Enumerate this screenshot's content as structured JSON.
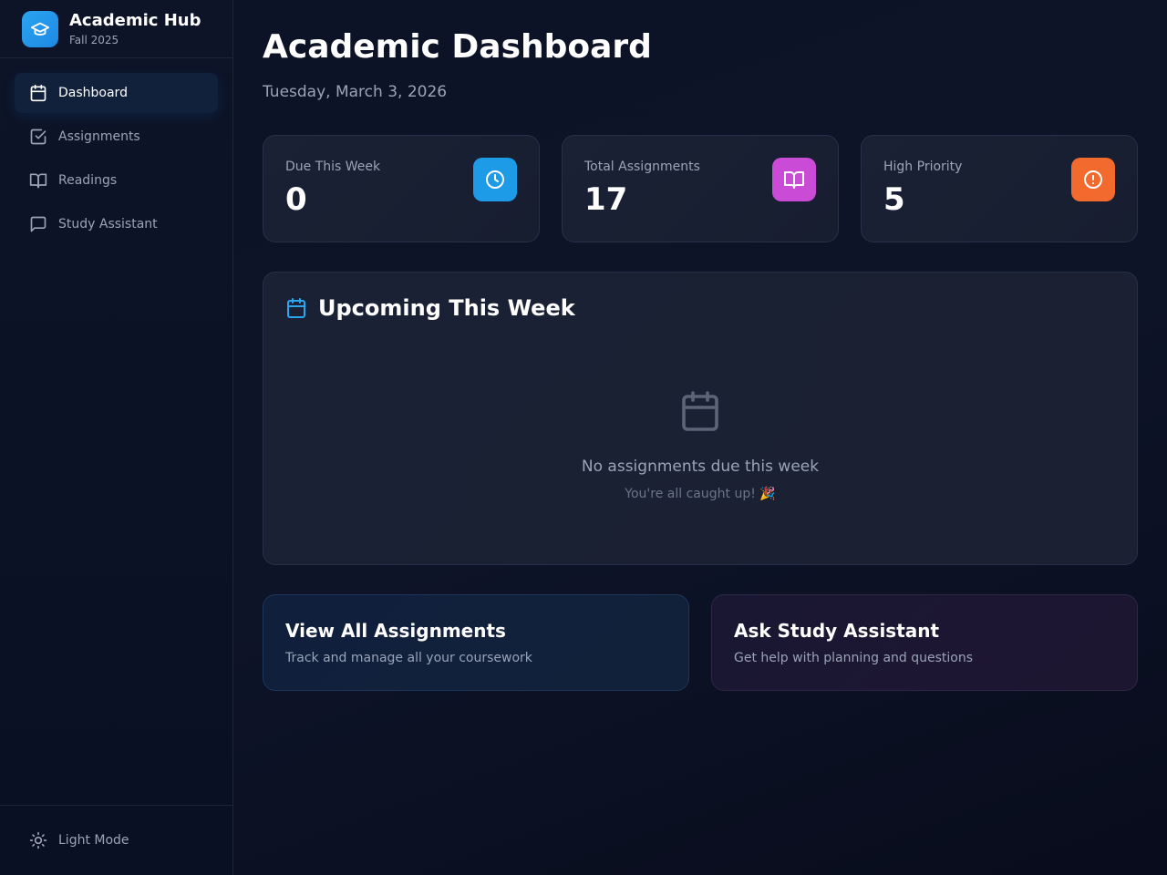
{
  "brand": {
    "title": "Academic Hub",
    "subtitle": "Fall 2025",
    "icon": "graduation-cap-icon"
  },
  "sidebar": {
    "items": [
      {
        "label": "Dashboard",
        "icon": "calendar-icon",
        "active": true
      },
      {
        "label": "Assignments",
        "icon": "checkbox-icon",
        "active": false
      },
      {
        "label": "Readings",
        "icon": "book-icon",
        "active": false
      },
      {
        "label": "Study Assistant",
        "icon": "chat-icon",
        "active": false
      }
    ],
    "footer": {
      "label": "Light Mode",
      "icon": "sun-icon"
    }
  },
  "header": {
    "title": "Academic Dashboard",
    "date": "Tuesday, March 3, 2026"
  },
  "stats": [
    {
      "label": "Due This Week",
      "value": "0",
      "icon": "clock-icon",
      "color": "#1e9be6"
    },
    {
      "label": "Total Assignments",
      "value": "17",
      "icon": "book-open-icon",
      "color": "#c94bd6"
    },
    {
      "label": "High Priority",
      "value": "5",
      "icon": "alert-circle-icon",
      "color": "#f26a2e"
    }
  ],
  "upcoming": {
    "title": "Upcoming This Week",
    "icon": "calendar-icon",
    "empty_title": "No assignments due this week",
    "empty_subtitle": "You're all caught up! 🎉"
  },
  "actions": [
    {
      "title": "View All Assignments",
      "description": "Track and manage all your coursework"
    },
    {
      "title": "Ask Study Assistant",
      "description": "Get help with planning and questions"
    }
  ],
  "colors": {
    "accent": "#1e9be6",
    "background": "#0b1022",
    "card": "#1a2134"
  }
}
